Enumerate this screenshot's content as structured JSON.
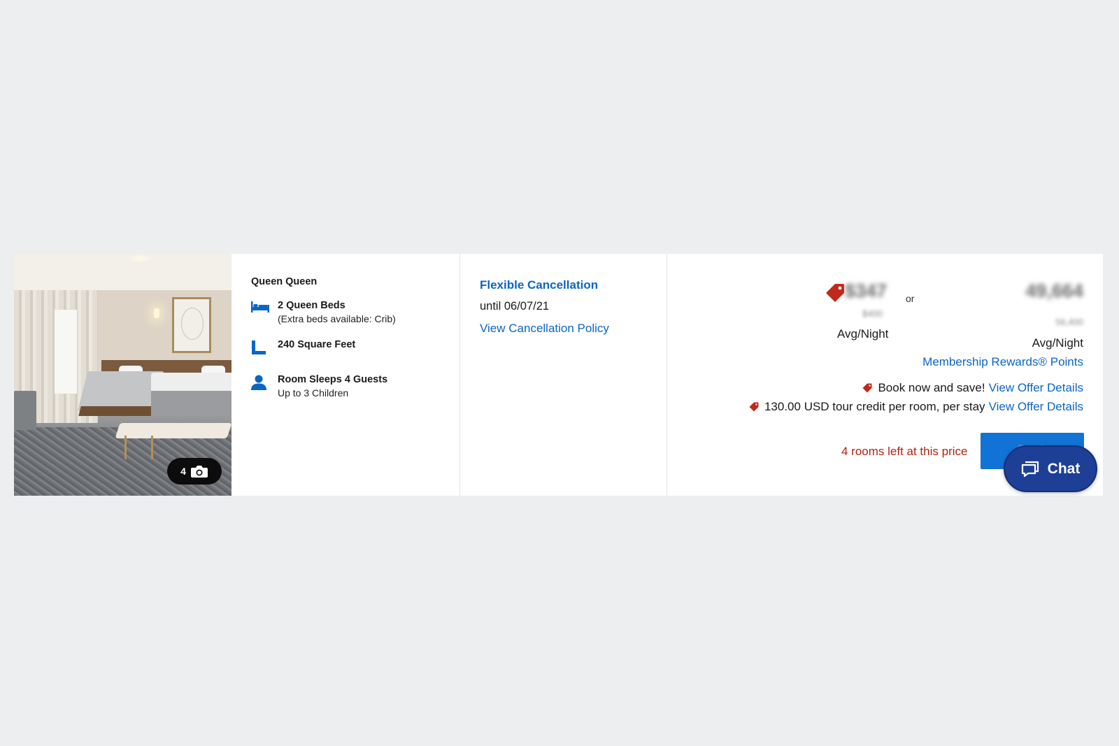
{
  "room": {
    "photo_count": "4",
    "title": "Queen Queen",
    "features": [
      {
        "icon": "bed-icon",
        "main": "2 Queen Beds",
        "sub": "(Extra beds available: Crib)"
      },
      {
        "icon": "ruler-icon",
        "main": "240 Square Feet",
        "sub": ""
      },
      {
        "icon": "person-icon",
        "main": "Room Sleeps 4 Guests",
        "sub": "Up to 3 Children"
      }
    ]
  },
  "cancellation": {
    "title": "Flexible Cancellation",
    "until": "until 06/07/21",
    "policy_link": "View Cancellation Policy"
  },
  "pricing": {
    "cash_price": "$347",
    "cash_strike": "$400",
    "cash_unit": "Avg/Night",
    "or_label": "or",
    "points_price": "49,664",
    "points_strike": "56,400",
    "points_unit": "Avg/Night",
    "points_link": "Membership Rewards® Points",
    "offers": [
      {
        "text": "Book now and save!",
        "link": "View Offer Details"
      },
      {
        "text": "130.00 USD tour credit per room, per stay",
        "link": "View Offer Details"
      }
    ],
    "rooms_left": "4 rooms left at this price",
    "book_label": "Book"
  },
  "chat": {
    "label": "Chat"
  },
  "colors": {
    "accent": "#0b66c3",
    "book_button": "#1273d6",
    "chat_button": "#1d3f95",
    "warning": "#b32210",
    "tag": "#c0281b",
    "background": "#edeef0"
  }
}
